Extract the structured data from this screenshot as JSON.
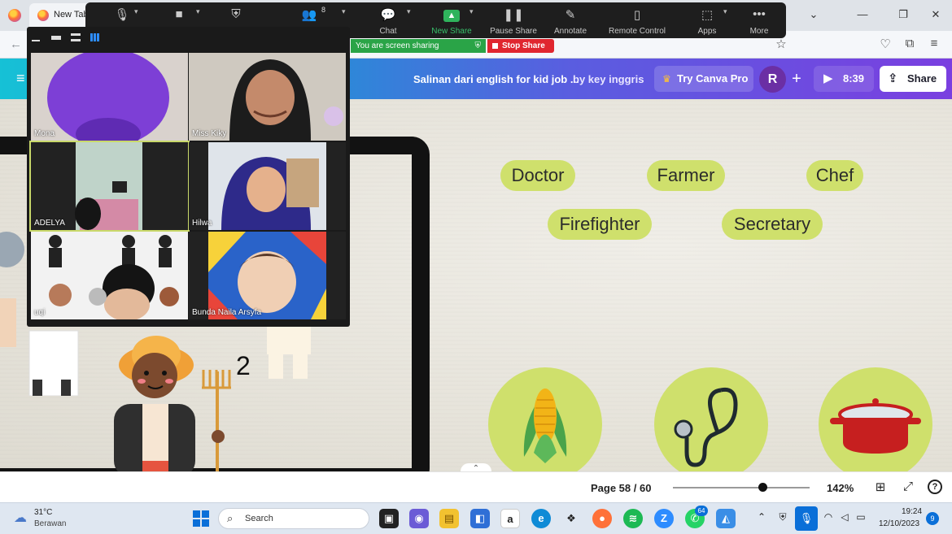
{
  "browser": {
    "tab_title": "New Tab",
    "icons": [
      "firefox-logo",
      "back-arrow",
      "star",
      "pocket",
      "extensions",
      "menu"
    ]
  },
  "zoom_toolbar": {
    "items": [
      {
        "id": "chat",
        "label": "Chat",
        "icon": "chat-bubble"
      },
      {
        "id": "new_share",
        "label": "New Share",
        "icon": "share-arrow-up"
      },
      {
        "id": "pause_share",
        "label": "Pause Share",
        "icon": "pause"
      },
      {
        "id": "annotate",
        "label": "Annotate",
        "icon": "pencil"
      },
      {
        "id": "remote_control",
        "label": "Remote Control",
        "icon": "mouse"
      },
      {
        "id": "apps",
        "label": "Apps",
        "icon": "apps"
      },
      {
        "id": "more",
        "label": "More",
        "icon": "dots"
      }
    ],
    "participants_count": "8",
    "sharing_banner": "You are screen sharing",
    "stop_share": "Stop Share"
  },
  "gallery": {
    "participants": [
      {
        "name": "Mona"
      },
      {
        "name": "Miss Kiky"
      },
      {
        "name": "ADELYA"
      },
      {
        "name": "Hilwa"
      },
      {
        "name": "uqi"
      },
      {
        "name": "Bunda Naila Arsyfa"
      }
    ]
  },
  "canva": {
    "doc_title": "Salinan dari english for kid job ...",
    "doc_by": "by key inggris",
    "try_pro": "Try Canva Pro",
    "avatar_initial": "R",
    "present_time": "8:39",
    "share_label": "Share",
    "page_indicator": "Page 58 / 60",
    "zoom_level": "142%",
    "zoom_fraction": 0.66
  },
  "slide": {
    "jobs": [
      "Doctor",
      "Farmer",
      "Chef",
      "Firefighter",
      "Secretary"
    ],
    "number_label": "2",
    "accent_color": "#cfe06c"
  },
  "taskbar": {
    "weather_temp": "31°C",
    "weather_desc": "Berawan",
    "search_placeholder": "Search",
    "app_badge": "64",
    "time": "19:24",
    "date": "12/10/2023",
    "notification_count": "9"
  }
}
